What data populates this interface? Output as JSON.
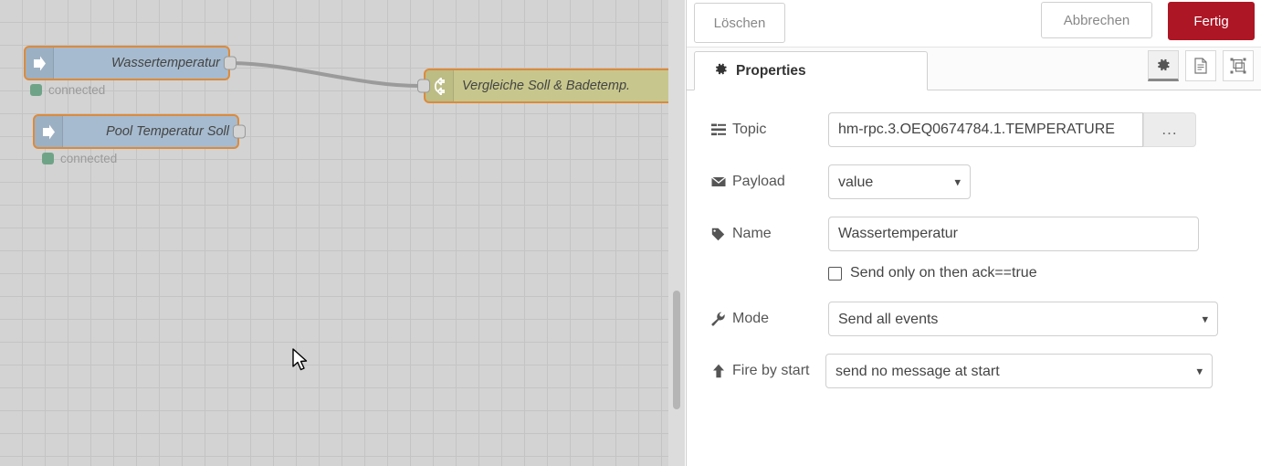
{
  "canvas": {
    "nodes": [
      {
        "id": "wassertemperatur",
        "label": "Wassertemperatur",
        "type": "inject",
        "icon": "arrow-right-icon",
        "status": "connected"
      },
      {
        "id": "pool-temperatur-soll",
        "label": "Pool Temperatur Soll",
        "type": "inject",
        "icon": "arrow-right-icon",
        "status": "connected"
      },
      {
        "id": "vergleiche-soll-badetemp",
        "label": "Vergleiche Soll & Badetemp.",
        "type": "switch",
        "icon": "switch-branch-icon",
        "status": ""
      }
    ]
  },
  "panel": {
    "header": {
      "delete_label": "Löschen",
      "cancel_label": "Abbrechen",
      "done_label": "Fertig",
      "done_color": "#ad1625"
    },
    "tabs": [
      {
        "label": "Properties",
        "icon": "gear-icon",
        "active": true
      }
    ],
    "tools": [
      {
        "name": "gear-icon",
        "active": true
      },
      {
        "name": "description-icon",
        "active": false
      },
      {
        "name": "appearance-icon",
        "active": false
      }
    ],
    "form": {
      "topic": {
        "label": "Topic",
        "icon": "tasks-icon",
        "value": "hm-rpc.3.OEQ0674784.1.TEMPERATURE",
        "placeholder": "",
        "browse_label": "..."
      },
      "payload": {
        "label": "Payload",
        "icon": "envelope-icon",
        "value": "value",
        "options": [
          "value"
        ]
      },
      "name": {
        "label": "Name",
        "icon": "tag-icon",
        "value": "Wassertemperatur",
        "placeholder": ""
      },
      "ack_checkbox": {
        "label": "Send only on then ack==true",
        "checked": false
      },
      "mode": {
        "label": "Mode",
        "icon": "wrench-icon",
        "value": "Send all events",
        "options": [
          "Send all events"
        ]
      },
      "fire_by_start": {
        "label": "Fire by start",
        "icon": "arrow-up-icon",
        "value": "send no message at start",
        "options": [
          "send no message at start"
        ]
      }
    }
  }
}
